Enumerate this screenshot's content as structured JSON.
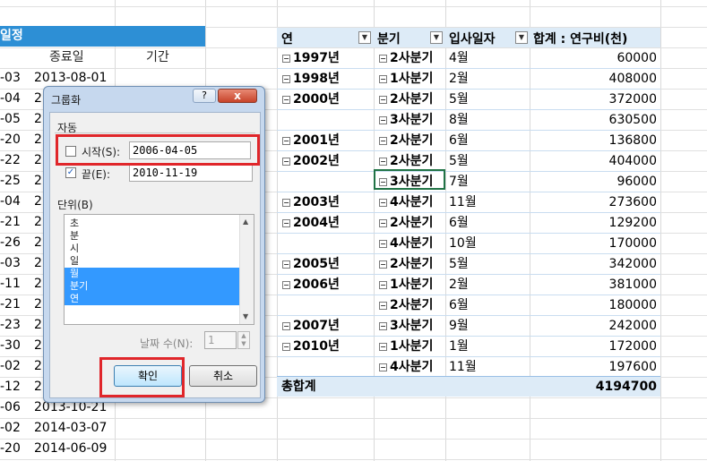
{
  "left_table": {
    "header": "일정",
    "col_end": "종료일",
    "col_period": "기간",
    "rows": [
      {
        "a": "-03",
        "b": "2013-08-01"
      },
      {
        "a": "-04",
        "b": "2"
      },
      {
        "a": "-05",
        "b": "2"
      },
      {
        "a": "-20",
        "b": "2"
      },
      {
        "a": "-22",
        "b": "2"
      },
      {
        "a": "-25",
        "b": "2"
      },
      {
        "a": "-04",
        "b": "2"
      },
      {
        "a": "-21",
        "b": "2"
      },
      {
        "a": "-26",
        "b": "2"
      },
      {
        "a": "-03",
        "b": "2"
      },
      {
        "a": "-11",
        "b": "2"
      },
      {
        "a": "-21",
        "b": "2"
      },
      {
        "a": "-23",
        "b": "2"
      },
      {
        "a": "-30",
        "b": "2"
      },
      {
        "a": "-02",
        "b": "2"
      },
      {
        "a": "-12",
        "b": "2"
      },
      {
        "a": "-06",
        "b": "2013-10-21"
      },
      {
        "a": "-02",
        "b": "2014-03-07"
      },
      {
        "a": "-20",
        "b": "2014-06-09"
      }
    ]
  },
  "pivot": {
    "headers": {
      "year": "연",
      "quarter": "분기",
      "hire_date": "입사일자",
      "sum": "합계 : 연구비(천)"
    },
    "rows": [
      {
        "year": "1997년",
        "quarter": "2사분기",
        "month": "4월",
        "value": "60000"
      },
      {
        "year": "1998년",
        "quarter": "1사분기",
        "month": "2월",
        "value": "408000"
      },
      {
        "year": "2000년",
        "quarter": "2사분기",
        "month": "5월",
        "value": "372000"
      },
      {
        "year": "",
        "quarter": "3사분기",
        "month": "8월",
        "value": "630500"
      },
      {
        "year": "2001년",
        "quarter": "2사분기",
        "month": "6월",
        "value": "136800"
      },
      {
        "year": "2002년",
        "quarter": "2사분기",
        "month": "5월",
        "value": "404000"
      },
      {
        "year": "",
        "quarter": "3사분기",
        "month": "7월",
        "value": "96000"
      },
      {
        "year": "2003년",
        "quarter": "4사분기",
        "month": "11월",
        "value": "273600"
      },
      {
        "year": "2004년",
        "quarter": "2사분기",
        "month": "6월",
        "value": "129200"
      },
      {
        "year": "",
        "quarter": "4사분기",
        "month": "10월",
        "value": "170000"
      },
      {
        "year": "2005년",
        "quarter": "2사분기",
        "month": "5월",
        "value": "342000"
      },
      {
        "year": "2006년",
        "quarter": "1사분기",
        "month": "2월",
        "value": "381000"
      },
      {
        "year": "",
        "quarter": "2사분기",
        "month": "6월",
        "value": "180000"
      },
      {
        "year": "2007년",
        "quarter": "3사분기",
        "month": "9월",
        "value": "242000"
      },
      {
        "year": "2010년",
        "quarter": "1사분기",
        "month": "1월",
        "value": "172000"
      },
      {
        "year": "",
        "quarter": "4사분기",
        "month": "11월",
        "value": "197600"
      }
    ],
    "total_label": "총합계",
    "total_value": "4194700"
  },
  "dialog": {
    "title": "그룹화",
    "help": "?",
    "close": "x",
    "auto_label": "자동",
    "start_label": "시작(S):",
    "start_value": "2006-04-05",
    "end_label": "끝(E):",
    "end_value": "2010-11-19",
    "unit_label": "단위(B)",
    "units": [
      "초",
      "분",
      "시",
      "일",
      "월",
      "분기",
      "연"
    ],
    "days_label": "날짜 수(N):",
    "days_value": "1",
    "ok": "확인",
    "cancel": "취소"
  }
}
